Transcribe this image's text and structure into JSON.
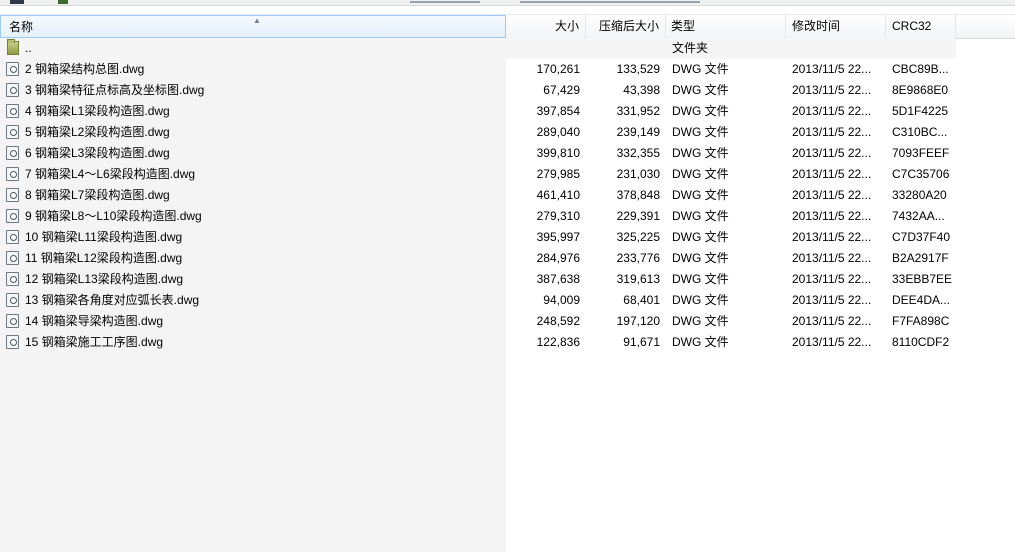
{
  "header": {
    "name": "名称",
    "size": "大小",
    "packed": "压缩后大小",
    "type": "类型",
    "modified": "修改时间",
    "crc": "CRC32"
  },
  "parent_row": {
    "name": "..",
    "type": "文件夹"
  },
  "files": [
    {
      "name": "2 钢箱梁结构总图.dwg",
      "size": "170,261",
      "packed": "133,529",
      "type": "DWG 文件",
      "modified": "2013/11/5 22...",
      "crc": "CBC89B..."
    },
    {
      "name": "3 钢箱梁特征点标高及坐标图.dwg",
      "size": "67,429",
      "packed": "43,398",
      "type": "DWG 文件",
      "modified": "2013/11/5 22...",
      "crc": "8E9868E0"
    },
    {
      "name": "4 钢箱梁L1梁段构造图.dwg",
      "size": "397,854",
      "packed": "331,952",
      "type": "DWG 文件",
      "modified": "2013/11/5 22...",
      "crc": "5D1F4225"
    },
    {
      "name": "5 钢箱梁L2梁段构造图.dwg",
      "size": "289,040",
      "packed": "239,149",
      "type": "DWG 文件",
      "modified": "2013/11/5 22...",
      "crc": "C310BC..."
    },
    {
      "name": "6 钢箱梁L3梁段构造图.dwg",
      "size": "399,810",
      "packed": "332,355",
      "type": "DWG 文件",
      "modified": "2013/11/5 22...",
      "crc": "7093FEEF"
    },
    {
      "name": "7 钢箱梁L4～L6梁段构造图.dwg",
      "size": "279,985",
      "packed": "231,030",
      "type": "DWG 文件",
      "modified": "2013/11/5 22...",
      "crc": "C7C35706"
    },
    {
      "name": "8 钢箱梁L7梁段构造图.dwg",
      "size": "461,410",
      "packed": "378,848",
      "type": "DWG 文件",
      "modified": "2013/11/5 22...",
      "crc": "33280A20"
    },
    {
      "name": "9 钢箱梁L8～L10梁段构造图.dwg",
      "size": "279,310",
      "packed": "229,391",
      "type": "DWG 文件",
      "modified": "2013/11/5 22...",
      "crc": "7432AA..."
    },
    {
      "name": "10 钢箱梁L11梁段构造图.dwg",
      "size": "395,997",
      "packed": "325,225",
      "type": "DWG 文件",
      "modified": "2013/11/5 22...",
      "crc": "C7D37F40"
    },
    {
      "name": "11 钢箱梁L12梁段构造图.dwg",
      "size": "284,976",
      "packed": "233,776",
      "type": "DWG 文件",
      "modified": "2013/11/5 22...",
      "crc": "B2A2917F"
    },
    {
      "name": "12 钢箱梁L13梁段构造图.dwg",
      "size": "387,638",
      "packed": "319,613",
      "type": "DWG 文件",
      "modified": "2013/11/5 22...",
      "crc": "33EBB7EE"
    },
    {
      "name": "13 钢箱梁各角度对应弧长表.dwg",
      "size": "94,009",
      "packed": "68,401",
      "type": "DWG 文件",
      "modified": "2013/11/5 22...",
      "crc": "DEE4DA..."
    },
    {
      "name": "14 钢箱梁导梁构造图.dwg",
      "size": "248,592",
      "packed": "197,120",
      "type": "DWG 文件",
      "modified": "2013/11/5 22...",
      "crc": "F7FA898C"
    },
    {
      "name": "15 钢箱梁施工工序图.dwg",
      "size": "122,836",
      "packed": "91,671",
      "type": "DWG 文件",
      "modified": "2013/11/5 22...",
      "crc": "8110CDF2"
    }
  ],
  "icons": {
    "file": "dwg-file-icon",
    "folder": "folder-icon",
    "sort": "sort-ascending-icon"
  },
  "colors": {
    "sorted_header_border": "#9ccaf0",
    "left_pane": "#f4f4f4"
  }
}
